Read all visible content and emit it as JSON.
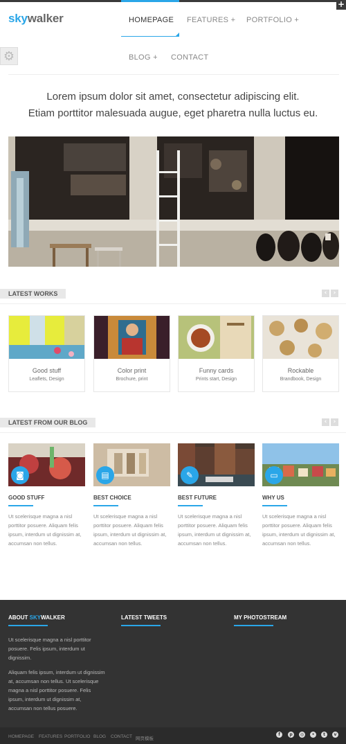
{
  "header": {
    "logo_sky": "sky",
    "logo_walker": "walker",
    "corner_glyph": "+",
    "nav": [
      {
        "label": "HOMEPAGE"
      },
      {
        "label": "FEATURES +"
      },
      {
        "label": "PORTFOLIO +"
      },
      {
        "label": "BLOG +"
      },
      {
        "label": "CONTACT"
      }
    ],
    "gear_glyph": "⚙"
  },
  "intro": {
    "line1": "Lorem ipsum dolor sit amet, consectetur adipiscing elit.",
    "line2": "Etiam porttitor malesuada augue, eget pharetra nulla luctus eu."
  },
  "latest_works": {
    "title": "LATEST WORKS",
    "prev": "‹",
    "next": "›",
    "items": [
      {
        "title": "Good stuff",
        "subtitle": "Leaflets, Design"
      },
      {
        "title": "Color print",
        "subtitle": "Brochure, print"
      },
      {
        "title": "Funny cards",
        "subtitle": "Prints start, Design"
      },
      {
        "title": "Rockable",
        "subtitle": "Brandbook, Design"
      }
    ]
  },
  "blog": {
    "title": "LATEST FROM OUR BLOG",
    "prev": "‹",
    "next": "›",
    "posts": [
      {
        "title": "GOOD STUFF",
        "icon": "camera-icon",
        "glyph": "◙",
        "text": "Ut scelerisque magna a nisl porttitor posuere. Aliquam felis ipsum, interdum ut dignissim at, accumsan non tellus."
      },
      {
        "title": "BEST CHOICE",
        "icon": "video-icon",
        "glyph": "▤",
        "text": "Ut scelerisque magna a nisl porttitor posuere. Aliquam felis ipsum, interdum ut dignissim at, accumsan non tellus."
      },
      {
        "title": "BEST FUTURE",
        "icon": "edit-icon",
        "glyph": "✎",
        "text": "Ut scelerisque magna a nisl porttitor posuere. Aliquam felis ipsum, interdum ut dignissim at, accumsan non tellus."
      },
      {
        "title": "WHY US",
        "icon": "card-icon",
        "glyph": "▭",
        "text": "Ut scelerisque magna a nisl porttitor posuere. Aliquam felis ipsum, interdum ut dignissim at, accumsan non tellus."
      }
    ]
  },
  "footer": {
    "about_prefix": "ABOUT ",
    "about_sky": "SKY",
    "about_walker": "WALKER",
    "about_p1": "Ut scelerisque magna a nisl porttitor posuere. Felis ipsum, interdum ut dignissim.",
    "about_p2": "Aliquam felis ipsum, interdum ut dignissim at, accumsan non tellus. Ut scelerisque magna a nisl porttitor posuere. Felis ipsum, interdum ut dignissim at, accumsan non tellus posuere.",
    "tweets_title": "LATEST TWEETS",
    "photos_title": "MY PHOTOSTREAM",
    "links": [
      "HOMEPAGE",
      "FEATURES",
      "PORTFOLIO",
      "BLOG",
      "CONTACT",
      "网页模板"
    ],
    "social": [
      {
        "name": "facebook-icon",
        "glyph": "f"
      },
      {
        "name": "pinterest-icon",
        "glyph": "p"
      },
      {
        "name": "dribbble-icon",
        "glyph": "◎"
      },
      {
        "name": "flickr-icon",
        "glyph": "•"
      },
      {
        "name": "twitter-icon",
        "glyph": "t"
      },
      {
        "name": "vimeo-icon",
        "glyph": "v"
      }
    ]
  },
  "colors": {
    "accent": "#2aa6e8",
    "footer_bg": "#333333"
  }
}
